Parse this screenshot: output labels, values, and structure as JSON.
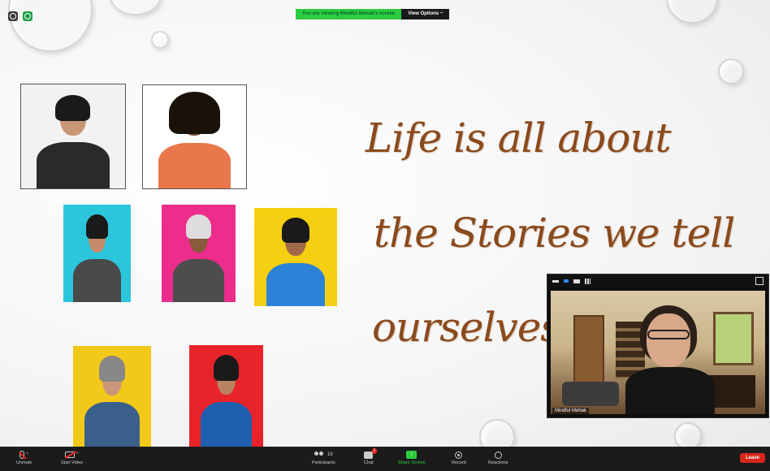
{
  "banner": {
    "message": "You are viewing Mindful Mehak's screen",
    "options_label": "View Options ~"
  },
  "slide": {
    "quote_lines": [
      "Life  is all about",
      "the Stories we tell",
      "ourselves"
    ]
  },
  "video_tile": {
    "participant_name": "Mindful Mehak"
  },
  "toolbar": {
    "unmute_label": "Unmute",
    "start_video_label": "Start Video",
    "participants_label": "Participants",
    "participants_count": "16",
    "chat_label": "Chat",
    "chat_badge": "1",
    "share_screen_label": "Share Screen",
    "record_label": "Record",
    "reactions_label": "Reactions",
    "leave_label": "Leave"
  },
  "colors": {
    "zoom_green": "#2ecc40",
    "leave_red": "#d9261c",
    "quote_brown": "#8b4a1c",
    "toolbar_bg": "#1b1b1b"
  },
  "icons": [
    "mic-muted-icon",
    "video-off-icon",
    "participants-icon",
    "chat-icon",
    "share-screen-icon",
    "record-icon",
    "reactions-icon"
  ]
}
